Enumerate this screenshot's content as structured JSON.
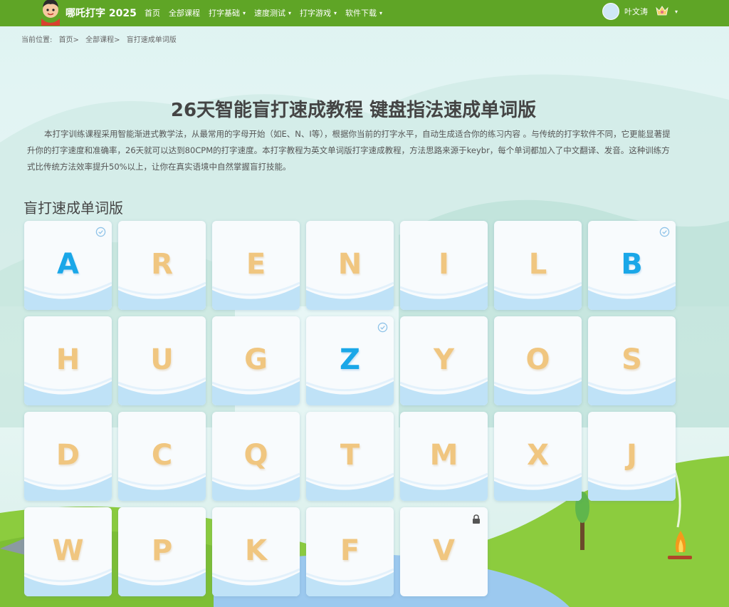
{
  "nav": {
    "brand": "哪吒打字 2025",
    "items": [
      {
        "label": "首页",
        "dropdown": false
      },
      {
        "label": "全部课程",
        "dropdown": false
      },
      {
        "label": "打字基础",
        "dropdown": true
      },
      {
        "label": "速度测试",
        "dropdown": true
      },
      {
        "label": "打字游戏",
        "dropdown": true
      },
      {
        "label": "软件下载",
        "dropdown": true
      }
    ],
    "user_name": "叶文涛"
  },
  "breadcrumb": {
    "prefix": "当前位置:",
    "items": [
      "首页>",
      "全部课程>",
      "盲打速成单词版"
    ]
  },
  "course": {
    "title": "26天智能盲打速成教程 键盘指法速成单词版",
    "intro": "本打字训练课程采用智能渐进式教学法，从最常用的字母开始（如E、N、I等），根据你当前的打字水平，自动生成适合你的练习内容 。与传统的打字软件不同，它更能显著提升你的打字速度和准确率，26天就可以达到80CPM的打字速度。本打字教程为英文单词版打字速成教程，方法思路来源于keybr，每个单词都加入了中文翻译、发音。这种训练方式比传统方法效率提升50%以上，让你在真实语境中自然掌握盲打技能。",
    "section_title": "盲打速成单词版"
  },
  "lessons": [
    {
      "letter": "A",
      "status": "done"
    },
    {
      "letter": "R",
      "status": "open"
    },
    {
      "letter": "E",
      "status": "open"
    },
    {
      "letter": "N",
      "status": "open"
    },
    {
      "letter": "I",
      "status": "open"
    },
    {
      "letter": "L",
      "status": "open"
    },
    {
      "letter": "B",
      "status": "done"
    },
    {
      "letter": "H",
      "status": "open"
    },
    {
      "letter": "U",
      "status": "open"
    },
    {
      "letter": "G",
      "status": "open"
    },
    {
      "letter": "Z",
      "status": "done"
    },
    {
      "letter": "Y",
      "status": "open"
    },
    {
      "letter": "O",
      "status": "open"
    },
    {
      "letter": "S",
      "status": "open"
    },
    {
      "letter": "D",
      "status": "open"
    },
    {
      "letter": "C",
      "status": "open"
    },
    {
      "letter": "Q",
      "status": "open"
    },
    {
      "letter": "T",
      "status": "open"
    },
    {
      "letter": "M",
      "status": "open"
    },
    {
      "letter": "X",
      "status": "open"
    },
    {
      "letter": "J",
      "status": "open"
    },
    {
      "letter": "W",
      "status": "open"
    },
    {
      "letter": "P",
      "status": "open"
    },
    {
      "letter": "K",
      "status": "open"
    },
    {
      "letter": "F",
      "status": "open"
    },
    {
      "letter": "V",
      "status": "locked"
    }
  ],
  "colors": {
    "nav_green": "#5fa526",
    "done_letter": "#1aa7e8",
    "open_letter": "#f0c680",
    "wave_blue": "#bfe2f7"
  }
}
